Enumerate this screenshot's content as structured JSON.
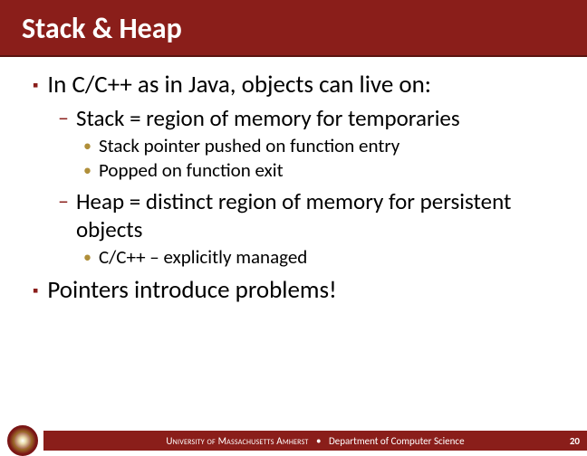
{
  "title": "Stack & Heap",
  "bullets": {
    "b1": "In C/C++ as in Java, objects can live on:",
    "b1_1": "Stack = region of memory for temporaries",
    "b1_1_1": "Stack pointer pushed on function entry",
    "b1_1_2": "Popped on function exit",
    "b1_2": "Heap = distinct region of memory for persistent objects",
    "b1_2_1": "C/C++ – explicitly managed",
    "b2": "Pointers introduce problems!"
  },
  "footer": {
    "university": "University of Massachusetts Amherst",
    "department": "Department of Computer Science",
    "separator": "•",
    "page": "20"
  }
}
